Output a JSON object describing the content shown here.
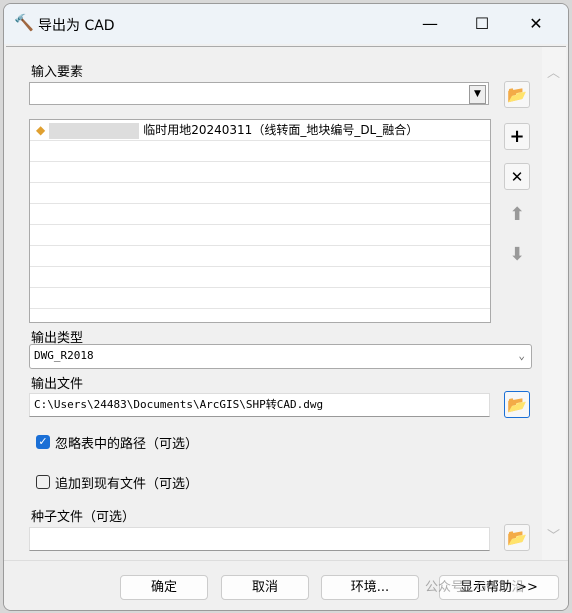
{
  "window": {
    "title": "导出为 CAD",
    "minimize": "—",
    "maximize": "☐",
    "close": "✕"
  },
  "input_features": {
    "label": "输入要素",
    "value": "",
    "items": [
      "临时用地20240311（线转面_地块编号_DL_融合）"
    ]
  },
  "side_buttons": {
    "add": "+",
    "remove": "✕",
    "up": "⬆",
    "down": "⬇"
  },
  "output_type": {
    "label": "输出类型",
    "value": "DWG_R2018"
  },
  "output_file": {
    "label": "输出文件",
    "value": "C:\\Users\\24483\\Documents\\ArcGIS\\SHP转CAD.dwg"
  },
  "ignore_paths": {
    "label": "忽略表中的路径（可选）",
    "checked": true
  },
  "append": {
    "label": "追加到现有文件（可选）",
    "checked": false
  },
  "seed_file": {
    "label": "种子文件（可选）",
    "value": ""
  },
  "footer": {
    "ok": "确定",
    "cancel": "取消",
    "env": "环境...",
    "help": "显示帮助 >>"
  },
  "watermark": "公众号 · GIS前沿"
}
